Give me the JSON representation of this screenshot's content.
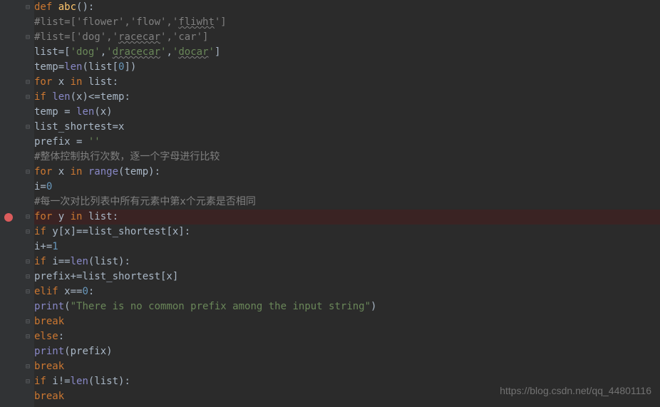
{
  "watermark": "https://blog.csdn.net/qq_44801116",
  "code": {
    "l1": {
      "kw_def": "def ",
      "fn": "abc",
      "rest": "():"
    },
    "l2": {
      "cmt": "#list=['flower','flow','",
      "wavy": "fliwht",
      "cmt2": "']"
    },
    "l3": {
      "cmt": "#list=['dog','",
      "wavy": "racecar",
      "cmt2": "','car']"
    },
    "l4": {
      "a": "list=[",
      "s1": "'dog'",
      "c": ",",
      "s2": "'",
      "w2": "dracecar",
      "s2b": "'",
      "c2": ",",
      "s3": "'",
      "w3": "docar",
      "s3b": "'",
      "z": "]"
    },
    "l5": {
      "a": "temp=",
      "fn": "len",
      "b": "(list[",
      "n": "0",
      "c": "])"
    },
    "l6": {
      "kw": "for ",
      "x": "x ",
      "kw2": "in ",
      "b": "list:"
    },
    "l7": {
      "kw": "if ",
      "fn": "len",
      "b": "(x)<=temp:"
    },
    "l8": {
      "a": "temp = ",
      "fn": "len",
      "b": "(x)"
    },
    "l9": {
      "a": "list_shortest=x"
    },
    "l10": {
      "a": "prefix = ",
      "s": "''"
    },
    "l11": {
      "cmt": "#整体控制执行次数，逐一个字母进行比较"
    },
    "l12": {
      "kw": "for ",
      "x": "x ",
      "kw2": "in ",
      "fn": "range",
      "b": "(temp):"
    },
    "l13": {
      "a": "i=",
      "n": "0"
    },
    "l14": {
      "cmt": "#每一次对比列表中所有元素中第x个元素是否相同"
    },
    "l15": {
      "kw": "for ",
      "y": "y ",
      "kw2": "in ",
      "b": "list:"
    },
    "l16": {
      "kw": "if ",
      "b": "y[x]==list_shortest[x]:"
    },
    "l17": {
      "a": "i+=",
      "n": "1"
    },
    "l18": {
      "kw": "if ",
      "a": "i==",
      "fn": "len",
      "b": "(list):"
    },
    "l19": {
      "a": "prefix+=list_shortest[x]"
    },
    "l20": {
      "kw": "elif ",
      "a": "x==",
      "n": "0",
      "b": ":"
    },
    "l21": {
      "fn": "print",
      "a": "(",
      "s": "\"There is no common prefix among the input string\"",
      "b": ")"
    },
    "l22": {
      "kw": "break"
    },
    "l23": {
      "kw": "else",
      "b": ":"
    },
    "l24": {
      "fn": "print",
      "a": "(prefix)"
    },
    "l25": {
      "kw": "break"
    },
    "l26": {
      "kw": "if ",
      "a": "i!=",
      "fn": "len",
      "b": "(list):"
    },
    "l27": {
      "kw": "break"
    }
  },
  "icons": {
    "fold_open": "⊟",
    "fold_close": "⊟",
    "fold_end": "⊟"
  }
}
